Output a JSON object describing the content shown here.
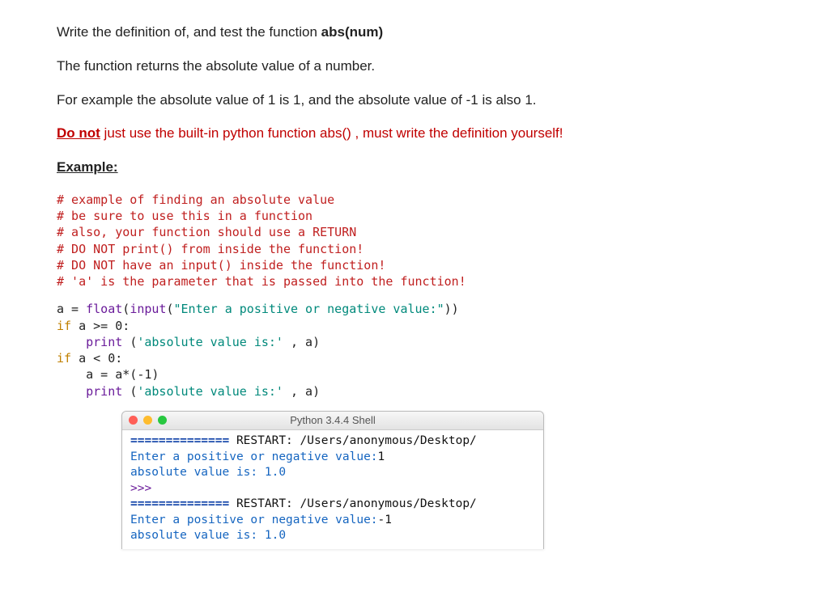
{
  "intro": {
    "p1a": "Write the definition of, and test the function ",
    "p1b": "abs(num)",
    "p2": "The function returns the absolute value of a number.",
    "p3": "For example the absolute value of 1 is 1, and the absolute value of -1 is also 1.",
    "p4a": "Do not",
    "p4b": " just use the built-in python function abs() , must write the definition yourself!",
    "example_label": "Example:"
  },
  "comments": [
    "# example of finding an absolute value",
    "# be sure to use this in a function",
    "# also, your function should use a RETURN",
    "# DO NOT print() from inside the function!",
    "# DO NOT have an input() inside the function!",
    "# 'a' is the parameter that is passed into the function!"
  ],
  "code": {
    "a": "a",
    "eq": " = ",
    "float": "float",
    "lparen": "(",
    "input": "input",
    "str_prompt": "\"Enter a positive or negative value:\"",
    "rparen2": "))",
    "if1": "if",
    "sp": " ",
    "cond1": "a >= 0:",
    "indent": "    ",
    "print": "print ",
    "str_abs": "'absolute value is:'",
    "comma_a": " , a)",
    "if2": "if",
    "cond2": "a < 0:",
    "assign2": "a = a*(-1)"
  },
  "shell": {
    "title": "Python 3.4.4 Shell",
    "sep": "============== ",
    "restart": "RESTART: ",
    "path": "/Users/anonymous/Desktop/",
    "prompt1": "Enter a positive or negative value:",
    "in1": "1",
    "out1": "absolute value is: 1.0",
    "chev": ">>> ",
    "in2": "-1",
    "out2": "absolute value is: 1.0"
  }
}
